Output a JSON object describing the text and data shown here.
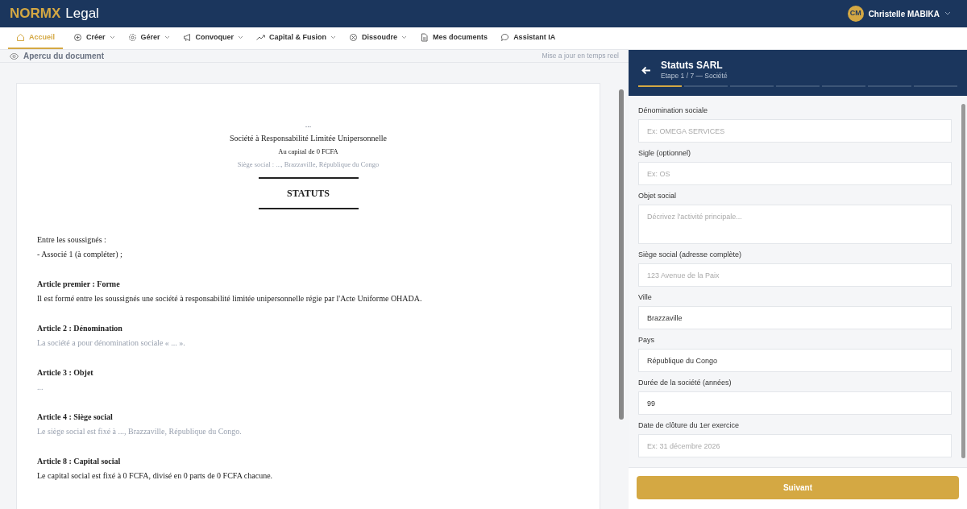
{
  "brand": {
    "primary": "NORMX",
    "secondary": "Legal"
  },
  "user": {
    "initials": "CM",
    "name": "Christelle MABIKA"
  },
  "nav": [
    {
      "label": "Accueil",
      "dropdown": false,
      "selected": true
    },
    {
      "label": "Créer",
      "dropdown": true,
      "selected": false
    },
    {
      "label": "Gérer",
      "dropdown": true,
      "selected": false
    },
    {
      "label": "Convoquer",
      "dropdown": true,
      "selected": false
    },
    {
      "label": "Capital & Fusion",
      "dropdown": true,
      "selected": false
    },
    {
      "label": "Dissoudre",
      "dropdown": true,
      "selected": false
    },
    {
      "label": "Mes documents",
      "dropdown": false,
      "selected": false
    },
    {
      "label": "Assistant IA",
      "dropdown": false,
      "selected": false
    }
  ],
  "preview": {
    "title": "Apercu du document",
    "status": "Mise a jour en temps reel",
    "document": {
      "name": "...",
      "form": "Société à Responsabilité Limitée Unipersonnelle",
      "capital": "Au capital de 0 FCFA",
      "seat": "Siège social : ..., Brazzaville, République du Congo",
      "heading": "STATUTS",
      "intro": [
        "Entre les soussignés :",
        "- Associé 1 (à compléter) ;"
      ],
      "articles": [
        {
          "title": "Article premier : Forme",
          "text": "Il est formé entre les soussignés une société à responsabilité limitée unipersonnelle régie par l'Acte Uniforme OHADA.",
          "muted": false
        },
        {
          "title": "Article 2 : Dénomination",
          "text": "La société a pour dénomination sociale « ... ».",
          "muted": true
        },
        {
          "title": "Article 3 : Objet",
          "text": "...",
          "muted": true
        },
        {
          "title": "Article 4 : Siège social",
          "text": "Le siège social est fixé à ..., Brazzaville, République du Congo.",
          "muted": true
        },
        {
          "title": "Article 8 : Capital social",
          "text": "Le capital social est fixé à 0 FCFA, divisé en 0 parts de 0 FCFA chacune.",
          "muted": false
        }
      ]
    }
  },
  "wizard": {
    "title": "Statuts SARL",
    "step": "Etape 1 / 7 — Société",
    "steps": [
      {
        "active": true
      },
      {
        "active": false
      },
      {
        "active": false
      },
      {
        "active": false
      },
      {
        "active": false
      },
      {
        "active": false
      },
      {
        "active": false
      }
    ],
    "fields": [
      {
        "label": "Dénomination sociale",
        "kind": "input",
        "placeholder": "Ex: OMEGA SERVICES"
      },
      {
        "label": "Sigle (optionnel)",
        "kind": "input",
        "placeholder": "Ex: OS"
      },
      {
        "label": "Objet social",
        "kind": "textarea",
        "placeholder": "Décrivez l'activité principale..."
      },
      {
        "label": "Siège social (adresse complète)",
        "kind": "input",
        "placeholder": "123 Avenue de la Paix"
      },
      {
        "label": "Ville",
        "kind": "input",
        "value": "Brazzaville"
      },
      {
        "label": "Pays",
        "kind": "input",
        "value": "République du Congo"
      },
      {
        "label": "Durée de la société (années)",
        "kind": "input",
        "value": "99"
      },
      {
        "label": "Date de clôture du 1er exercice",
        "kind": "input",
        "placeholder": "Ex: 31 décembre 2026"
      }
    ],
    "next": "Suivant"
  }
}
